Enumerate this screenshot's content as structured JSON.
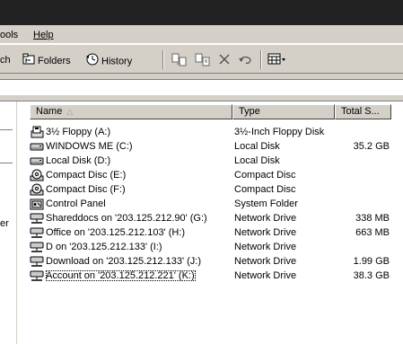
{
  "menubar": {
    "items": [
      {
        "label": "ools"
      },
      {
        "label": "Help"
      }
    ]
  },
  "toolbar": {
    "search_fragment": "ch",
    "folders": "Folders",
    "history": "History"
  },
  "columns": [
    {
      "label": "Name",
      "sort": "ascending"
    },
    {
      "label": "Type"
    },
    {
      "label": "Total S..."
    }
  ],
  "left_pane": {
    "label_fragment": "er"
  },
  "rows": [
    {
      "name": "3½ Floppy (A:)",
      "type": "3½-Inch Floppy Disk",
      "size": "",
      "icon": "floppy-drive-icon"
    },
    {
      "name": "WINDOWS ME (C:)",
      "type": "Local Disk",
      "size": "35.2 GB",
      "icon": "hard-disk-icon"
    },
    {
      "name": "Local Disk (D:)",
      "type": "Local Disk",
      "size": "",
      "icon": "hard-disk-icon"
    },
    {
      "name": "Compact Disc (E:)",
      "type": "Compact Disc",
      "size": "",
      "icon": "cd-drive-icon"
    },
    {
      "name": "Compact Disc (F:)",
      "type": "Compact Disc",
      "size": "",
      "icon": "cd-drive-icon"
    },
    {
      "name": "Control Panel",
      "type": "System Folder",
      "size": "",
      "icon": "control-panel-icon"
    },
    {
      "name": "Shareddocs on '203.125.212.90' (G:)",
      "type": "Network Drive",
      "size": "338 MB",
      "icon": "network-drive-icon"
    },
    {
      "name": "Office on '203.125.212.103' (H:)",
      "type": "Network Drive",
      "size": "663 MB",
      "icon": "network-drive-icon"
    },
    {
      "name": "D on '203.125.212.133' (I:)",
      "type": "Network Drive",
      "size": "",
      "icon": "network-drive-icon"
    },
    {
      "name": "Download on '203.125.212.133' (J:)",
      "type": "Network Drive",
      "size": "1.99 GB",
      "icon": "network-drive-icon"
    },
    {
      "name": "Account on '203.125.212.221' (K:)",
      "type": "Network Drive",
      "size": "38.3 GB",
      "icon": "network-drive-icon",
      "focused": true
    }
  ]
}
